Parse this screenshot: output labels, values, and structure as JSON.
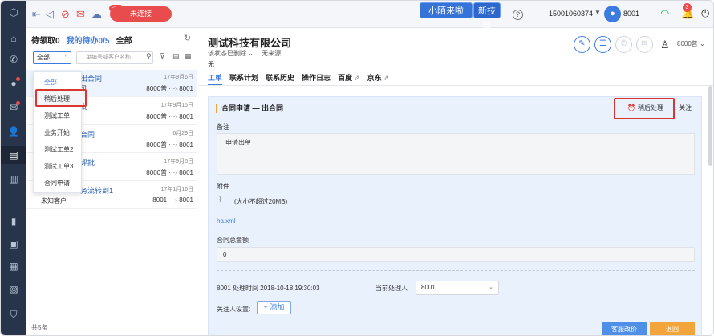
{
  "nav": {
    "items": [
      "home",
      "phone",
      "chat",
      "mail",
      "contacts",
      "tickets",
      "book",
      "reports",
      "monitor",
      "dashboard",
      "calendar",
      "security"
    ]
  },
  "topbar": {
    "badge_count": "99+",
    "status_button": "未连接",
    "promo_primary": "小陌来啦",
    "promo_secondary": "新技能",
    "help": "?",
    "phone_number": "15001060374",
    "agent_id": "8001",
    "bell_count": "3"
  },
  "list": {
    "tabs": [
      {
        "label": "待领取0",
        "active": false
      },
      {
        "label": "我的待办0/5",
        "active": true
      },
      {
        "label": "全部",
        "active": false
      }
    ],
    "filter_value": "全部",
    "search_placeholder": "工单编号或客户名称",
    "rows": [
      {
        "title": "出合同",
        "sub": "司",
        "date": "17年9月6日",
        "flow": "8000普 ···› 8001"
      },
      {
        "title": "批",
        "sub": "",
        "date": "17年9月15日",
        "flow": "8000普 ···› 8001"
      },
      {
        "title": "合同",
        "sub": "",
        "date": "6月29日",
        "flow": "8000普 ···› 8001"
      },
      {
        "title": "评批",
        "sub": "",
        "date": "17年9月6日",
        "flow": "8000普 ···› 8001"
      },
      {
        "title": "务流转到1",
        "sub": "未知客户",
        "date": "17年1月16日",
        "flow": "8001 ···› 8001"
      }
    ],
    "count_text": "共5条"
  },
  "dropdown": {
    "items": [
      {
        "label": "全部",
        "active": true
      },
      {
        "label": "稍后处理",
        "active": false
      },
      {
        "label": "测试工单",
        "active": false
      },
      {
        "label": "业务开始",
        "active": false
      },
      {
        "label": "测试工单2",
        "active": false
      },
      {
        "label": "测试工单3",
        "active": false
      },
      {
        "label": "合同申请",
        "active": false
      }
    ]
  },
  "detail": {
    "company": "测试科技有限公司",
    "status": "该状态已删除",
    "source": "无来源",
    "extra": "无",
    "owner": "8000普",
    "tabs": [
      {
        "label": "工单",
        "active": true
      },
      {
        "label": "联系计划",
        "active": false
      },
      {
        "label": "联系历史",
        "active": false
      },
      {
        "label": "操作日志",
        "active": false
      },
      {
        "label": "百度",
        "active": false
      },
      {
        "label": "京东",
        "active": false
      }
    ],
    "card_title": "合同申请 — 出合同",
    "later_label": "稍后处理",
    "follow_label": "关注",
    "note_label": "备注",
    "note_value": "申请出单",
    "attach_label": "附件",
    "attach_hint": "(大小不超过20MB)",
    "file_name": "ha.xml",
    "amount_label": "合同总金额",
    "amount_value": "0",
    "process_info": "8001 处理时间 2018-10-18 19:30:03",
    "handler_label": "当前处理人",
    "handler_value": "8001",
    "follower_label": "关注人设置:",
    "add_label": "+ 添加",
    "btn_price": "客服改价",
    "btn_back": "退回"
  },
  "colors": {
    "accent": "#3c7be0",
    "nav_bg": "#27344a",
    "danger": "#e84c4c",
    "warning": "#f2a53b",
    "highlight_box": "#d9372d"
  }
}
